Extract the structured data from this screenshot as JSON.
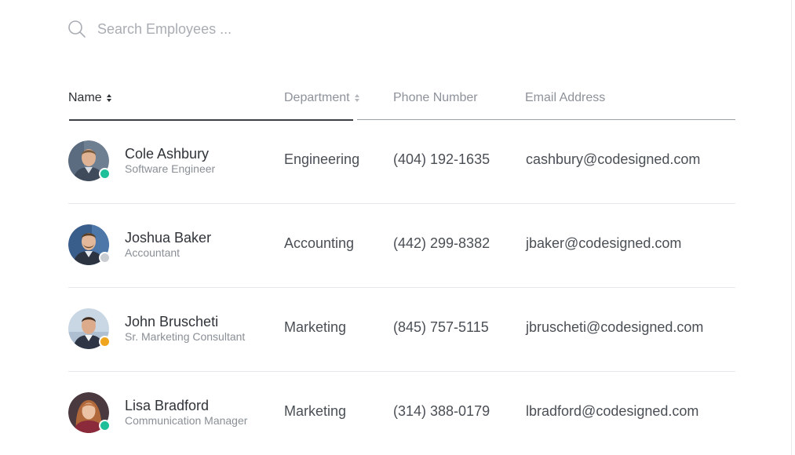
{
  "search": {
    "placeholder": "Search Employees ...",
    "value": ""
  },
  "table": {
    "columns": [
      {
        "label": "Name",
        "sortable": true,
        "active": true
      },
      {
        "label": "Department",
        "sortable": true,
        "active": false
      },
      {
        "label": "Phone Number",
        "sortable": false,
        "active": false
      },
      {
        "label": "Email Address",
        "sortable": false,
        "active": false
      }
    ],
    "rows": [
      {
        "name": "Cole Ashbury",
        "role": "Software Engineer",
        "department": "Engineering",
        "phone": "(404) 192-1635",
        "email": "cashbury@codesigned.com",
        "status_color": "#1fbf9a"
      },
      {
        "name": "Joshua Baker",
        "role": "Accountant",
        "department": "Accounting",
        "phone": "(442) 299-8382",
        "email": "jbaker@codesigned.com",
        "status_color": "#c9cdd2"
      },
      {
        "name": "John Bruscheti",
        "role": "Sr. Marketing Consultant",
        "department": "Marketing",
        "phone": "(845) 757-5115",
        "email": "jbruscheti@codesigned.com",
        "status_color": "#f0a51f"
      },
      {
        "name": "Lisa Bradford",
        "role": "Communication Manager",
        "department": "Marketing",
        "phone": "(314) 388-0179",
        "email": "lbradford@codesigned.com",
        "status_color": "#1fbf9a"
      }
    ]
  }
}
